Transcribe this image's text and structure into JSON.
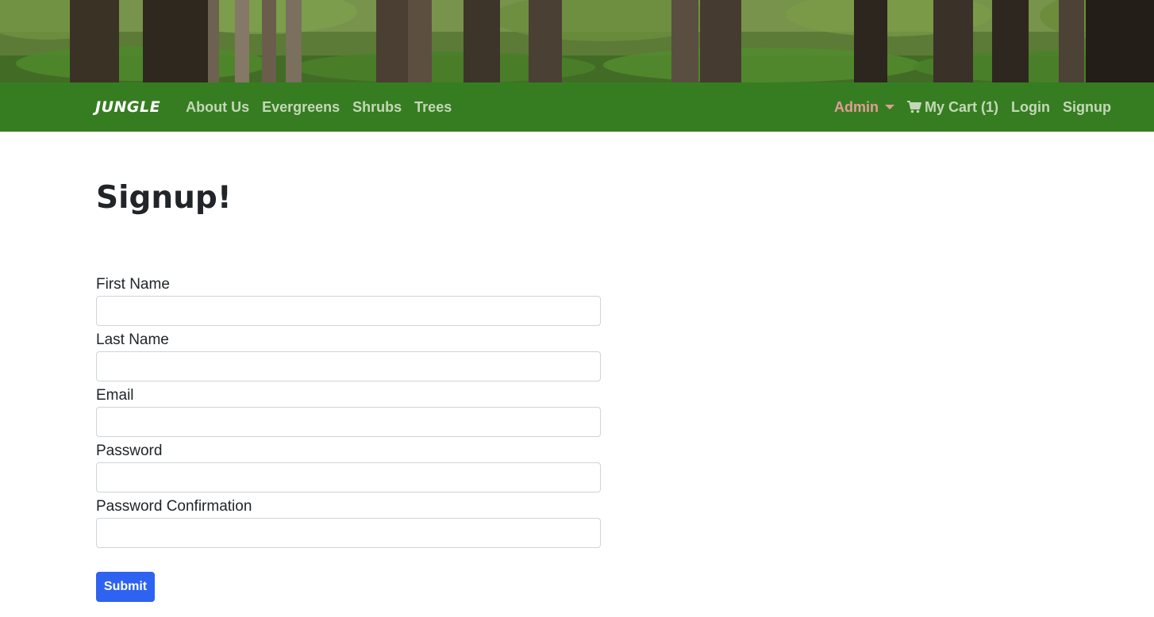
{
  "brand": {
    "label": "JUNGLE"
  },
  "nav": {
    "left": [
      {
        "label": "About Us"
      },
      {
        "label": "Evergreens"
      },
      {
        "label": "Shrubs"
      },
      {
        "label": "Trees"
      }
    ],
    "admin_label": "Admin",
    "cart_label": "My Cart (1)",
    "login_label": "Login",
    "signup_label": "Signup"
  },
  "page": {
    "title": "Signup!"
  },
  "form": {
    "first_name_label": "First Name",
    "first_name_value": "",
    "last_name_label": "Last Name",
    "last_name_value": "",
    "email_label": "Email",
    "email_value": "",
    "password_label": "Password",
    "password_value": "",
    "password_confirmation_label": "Password Confirmation",
    "password_confirmation_value": "",
    "submit_label": "Submit"
  },
  "colors": {
    "navbar_bg": "#367d21",
    "nav_link": "#cfe0c4",
    "admin_link": "#f0a0a0",
    "submit_bg": "#2d63f0"
  },
  "icons": {
    "cart": "shopping-cart-icon",
    "admin_dropdown": "caret-down-icon"
  }
}
